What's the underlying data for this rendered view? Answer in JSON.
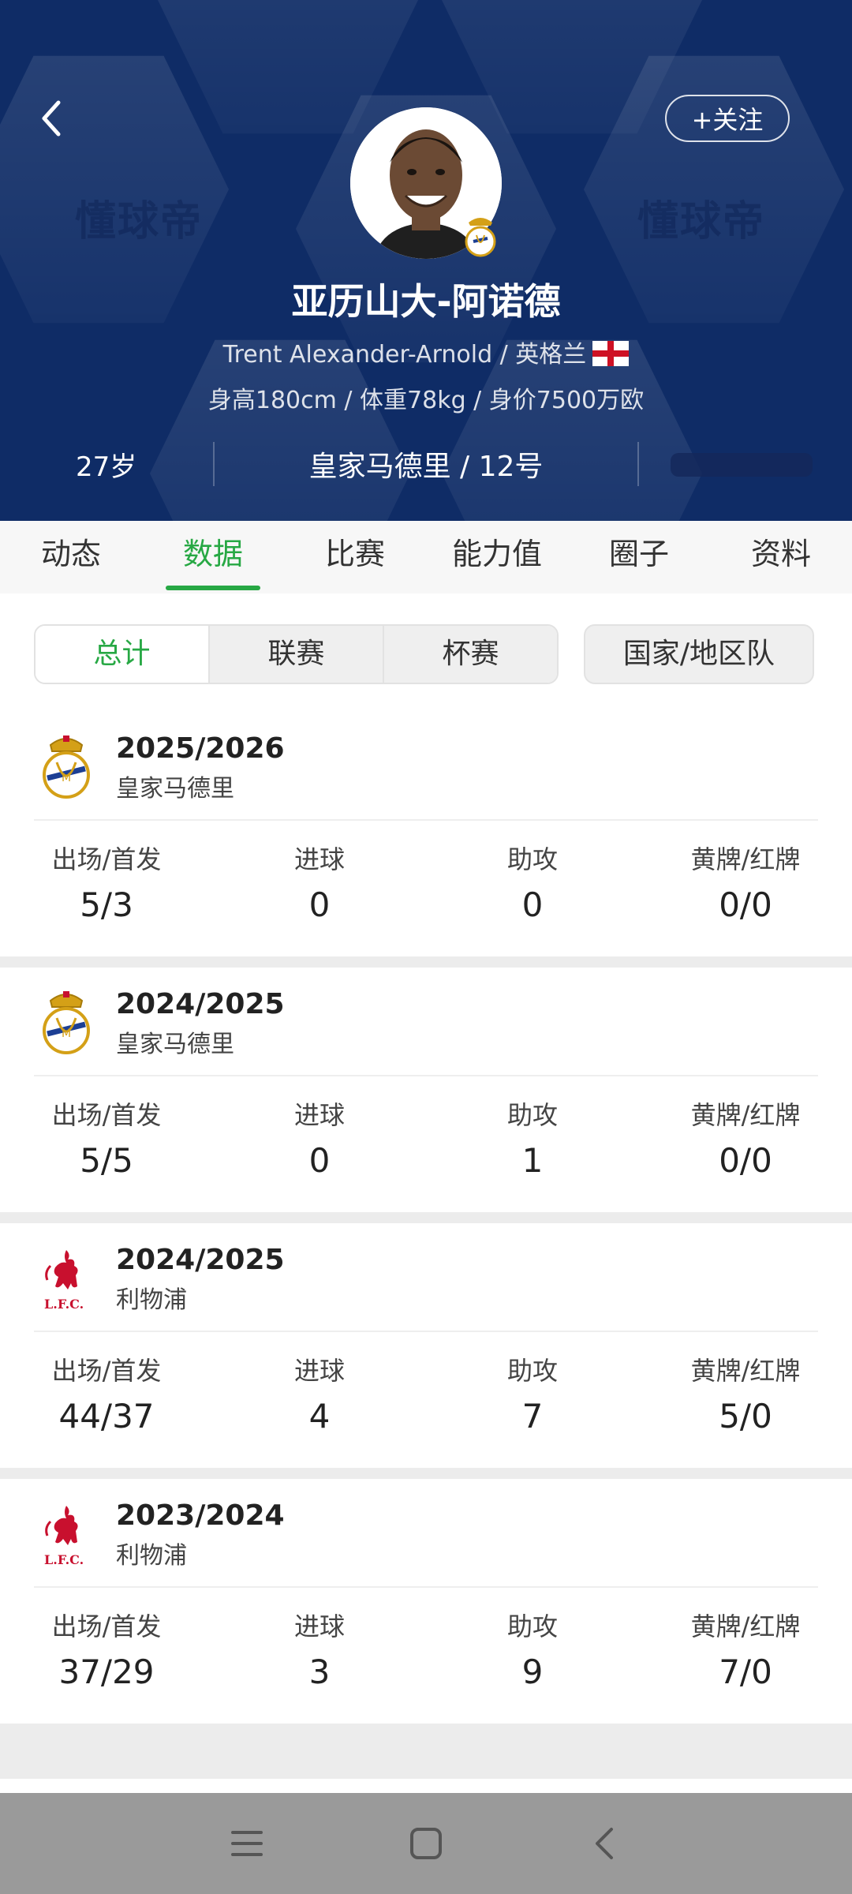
{
  "header": {
    "follow_label": "+关注",
    "name_cn": "亚历山大-阿诺德",
    "name_en_nation": "Trent Alexander-Arnold / 英格兰",
    "body_info": "身高180cm / 体重78kg / 身价7500万欧",
    "age": "27岁",
    "club_number": "皇家马德里 / 12号",
    "watermark": "懂球帝",
    "bg_color": "#0f2c66"
  },
  "tabs": [
    {
      "label": "动态"
    },
    {
      "label": "数据",
      "active": true
    },
    {
      "label": "比赛"
    },
    {
      "label": "能力值"
    },
    {
      "label": "圈子"
    },
    {
      "label": "资料"
    }
  ],
  "filters": {
    "segments": [
      "总计",
      "联赛",
      "杯赛"
    ],
    "country": "国家/地区队",
    "active_color": "#27a844"
  },
  "stat_labels": {
    "apps": "出场/首发",
    "goals": "进球",
    "assists": "助攻",
    "cards": "黄牌/红牌"
  },
  "seasons": [
    {
      "year": "2025/2026",
      "club": "皇家马德里",
      "crest": "real-madrid",
      "apps": "5/3",
      "goals": "0",
      "assists": "0",
      "cards": "0/0"
    },
    {
      "year": "2024/2025",
      "club": "皇家马德里",
      "crest": "real-madrid",
      "apps": "5/5",
      "goals": "0",
      "assists": "1",
      "cards": "0/0"
    },
    {
      "year": "2024/2025",
      "club": "利物浦",
      "crest": "liverpool",
      "apps": "44/37",
      "goals": "4",
      "assists": "7",
      "cards": "5/0"
    },
    {
      "year": "2023/2024",
      "club": "利物浦",
      "crest": "liverpool",
      "apps": "37/29",
      "goals": "3",
      "assists": "9",
      "cards": "7/0"
    }
  ],
  "navbar": {
    "icons": [
      "menu-icon",
      "home-square-icon",
      "back-arrow-icon"
    ]
  }
}
